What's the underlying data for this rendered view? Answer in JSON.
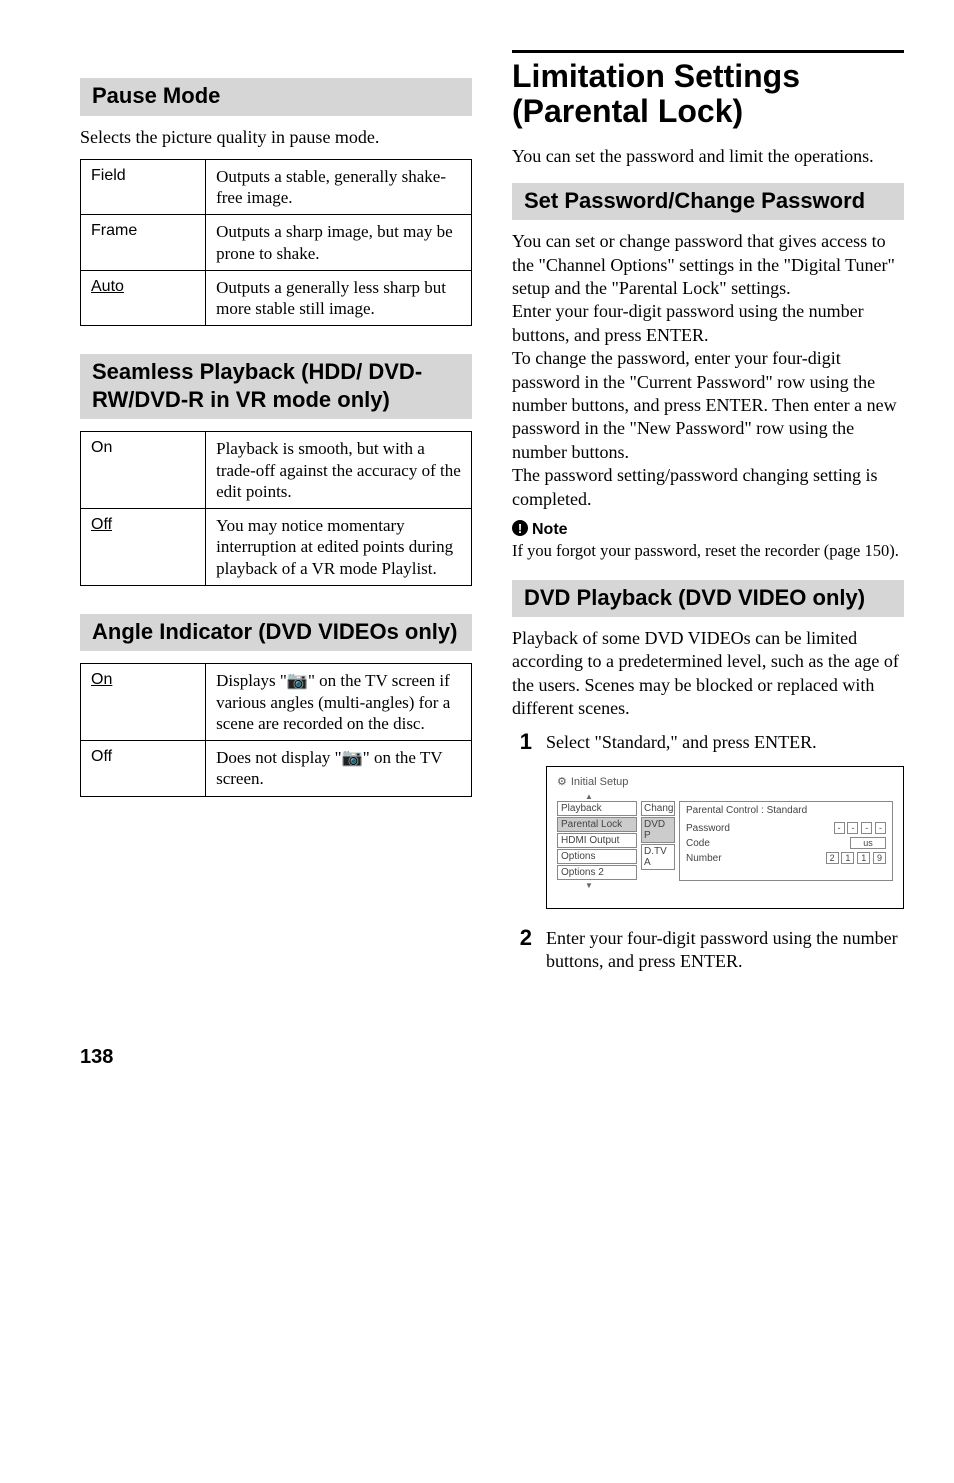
{
  "page_number": "138",
  "left": {
    "pause_mode": {
      "heading": "Pause Mode",
      "intro": "Selects the picture quality in pause mode.",
      "rows": [
        {
          "key": "Field",
          "val": "Outputs a stable, generally shake-free image."
        },
        {
          "key": "Frame",
          "val": "Outputs a sharp image, but may be prone to shake."
        },
        {
          "key": "Auto",
          "val": "Outputs a generally less sharp but more stable still image.",
          "underline": true
        }
      ]
    },
    "seamless": {
      "heading": "Seamless Playback (HDD/ DVD-RW/DVD-R in VR mode only)",
      "rows": [
        {
          "key": "On",
          "val": "Playback is smooth, but with a trade-off against the accuracy of the edit points."
        },
        {
          "key": "Off",
          "val": "You may notice momentary interruption at edited points during playback of a VR mode Playlist.",
          "underline": true
        }
      ]
    },
    "angle": {
      "heading": "Angle Indicator (DVD VIDEOs only)",
      "rows": [
        {
          "key": "On",
          "val_before": "Displays \"",
          "val_after": "\" on the TV screen if various angles (multi-angles) for a scene are recorded on the disc.",
          "underline": true,
          "has_icon": true
        },
        {
          "key": "Off",
          "val_before": "Does not display \"",
          "val_after": "\" on the TV screen.",
          "has_icon": true
        }
      ]
    }
  },
  "right": {
    "title": "Limitation Settings (Parental Lock)",
    "intro": "You can set the password and limit the operations.",
    "set_password": {
      "heading": "Set Password/Change Password",
      "para": "You can set or change password that gives access to the \"Channel Options\" settings in the \"Digital Tuner\" setup and the \"Parental Lock\" settings.\nEnter your four-digit password using the number buttons, and press ENTER.\nTo change the password, enter your four-digit password in the \"Current Password\" row using the number buttons, and press ENTER. Then enter a new password in the \"New Password\" row using the number buttons.\nThe password setting/password changing setting is completed.",
      "note_label": "Note",
      "note_body": "If you forgot your password, reset the recorder (page 150)."
    },
    "dvd_playback": {
      "heading": "DVD Playback (DVD VIDEO only)",
      "intro": "Playback of some DVD VIDEOs can be limited according to a predetermined level, such as the age of the users. Scenes may be blocked or replaced with different scenes.",
      "steps": [
        "Select \"Standard,\" and press ENTER.",
        "Enter your four-digit password using the number buttons, and press ENTER."
      ],
      "screenshot": {
        "title": "Initial Setup",
        "left_items": [
          "Playback",
          "Parental Lock",
          "HDMI Output",
          "Options",
          "Options 2"
        ],
        "left_sel_index": 1,
        "mid_items": [
          "Chang",
          "DVD P",
          "D.TV A"
        ],
        "mid_sel_index": 1,
        "right_header": "Parental Control : Standard",
        "right_rows": [
          {
            "label": "Password",
            "boxes": [
              "-",
              "-",
              "-",
              "-"
            ]
          },
          {
            "label": "Code",
            "boxes": [
              "us"
            ]
          },
          {
            "label": "Number",
            "boxes": [
              "2",
              "1",
              "1",
              "9"
            ]
          }
        ]
      }
    }
  }
}
